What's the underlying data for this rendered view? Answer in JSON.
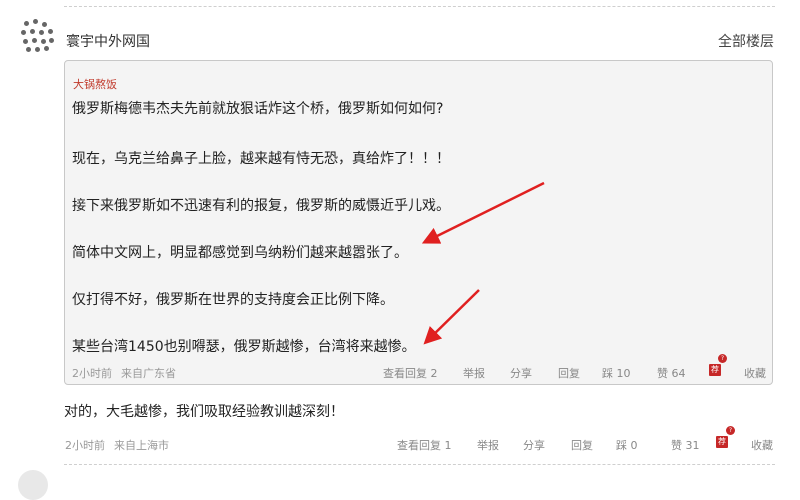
{
  "user": {
    "name": "寰宇中外网国"
  },
  "header": {
    "all_floors": "全部楼层"
  },
  "quote": {
    "author": "大锅熬饭",
    "lines": [
      "俄罗斯梅德韦杰夫先前就放狠话炸这个桥，俄罗斯如何如何?",
      "现在，乌克兰给鼻子上脸，越来越有恃无恐，真给炸了！！！",
      "接下来俄罗斯如不迅速有利的报复，俄罗斯的威慑近乎儿戏。",
      "简体中文网上，明显都感觉到乌纳粉们越来越嚣张了。",
      "仅打得不好，俄罗斯在世界的支持度会正比例下降。",
      "某些台湾1450也别嘚瑟，俄罗斯越惨，台湾将来越惨。"
    ],
    "time": "2小时前",
    "location": "来自广东省",
    "actions": {
      "view_replies": "查看回复 2",
      "report": "举报",
      "share": "分享",
      "reply": "回复",
      "dislike": "踩 10",
      "like": "赞 64",
      "recommend": "荐",
      "recommend_badge": "?",
      "favorite": "收藏"
    }
  },
  "reply": {
    "text": "对的，大毛越惨，我们吸取经验教训越深刻！",
    "time": "2小时前",
    "location": "来自上海市",
    "actions": {
      "view_replies": "查看回复 1",
      "report": "举报",
      "share": "分享",
      "reply": "回复",
      "dislike": "踩 0",
      "like": "赞 31",
      "recommend": "荐",
      "recommend_badge": "?",
      "favorite": "收藏"
    }
  },
  "colors": {
    "arrow": "#e02020",
    "author": "#c0392b",
    "recommend": "#c62828"
  }
}
